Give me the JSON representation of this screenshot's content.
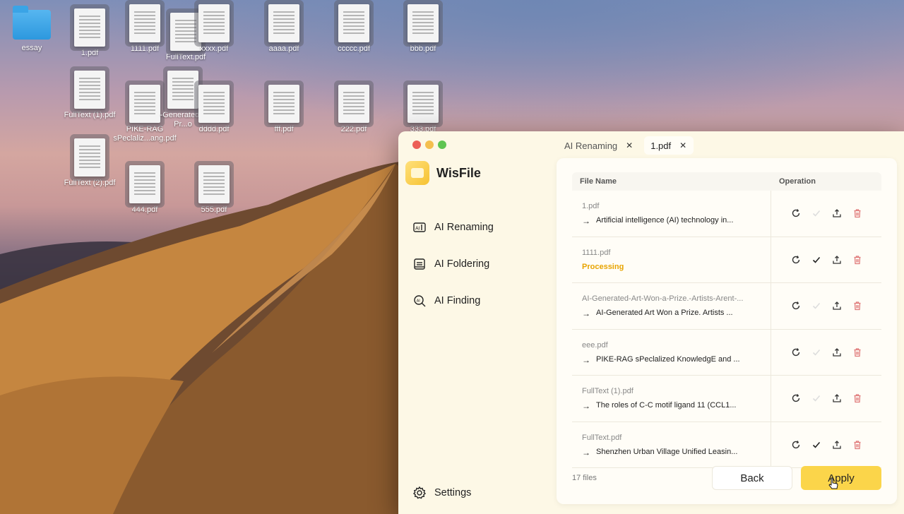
{
  "desktop": {
    "icons": [
      {
        "name": "essay",
        "type": "folder"
      },
      {
        "name": "1.pdf"
      },
      {
        "name": "1111.pdf"
      },
      {
        "name": "FullText.pdf"
      },
      {
        "name": "xxxx.pdf"
      },
      {
        "name": "aaaa.pdf"
      },
      {
        "name": "ccccc.pdf"
      },
      {
        "name": "bbb.pdf"
      },
      {
        "name": "FullText (1).pdf"
      },
      {
        "name": "PIKE-RAG sPeclaliz...ang.pdf"
      },
      {
        "name": "-Generated a Pr...o"
      },
      {
        "name": "dddd.pdf"
      },
      {
        "name": "fff.pdf"
      },
      {
        "name": "222.pdf"
      },
      {
        "name": "333.pdf"
      },
      {
        "name": "FullText (2).pdf"
      },
      {
        "name": "444.pdf"
      },
      {
        "name": "555.pdf"
      }
    ]
  },
  "app": {
    "name": "WisFile",
    "tabs": [
      {
        "label": "AI Renaming",
        "active": false
      },
      {
        "label": "1.pdf",
        "active": true
      }
    ],
    "nav": [
      {
        "label": "AI Renaming",
        "icon": "ai-rename-icon"
      },
      {
        "label": "AI Foldering",
        "icon": "ai-folder-icon"
      },
      {
        "label": "AI Finding",
        "icon": "ai-search-icon"
      }
    ],
    "settings_label": "Settings",
    "table": {
      "col_name": "File Name",
      "col_op": "Operation",
      "rows": [
        {
          "original": "1.pdf",
          "new": "Artificial intelligence (AI) technology in...",
          "status": "",
          "check_active": false
        },
        {
          "original": "1111.pdf",
          "new": "",
          "status": "Processing",
          "check_active": true
        },
        {
          "original": "AI-Generated-Art-Won-a-Prize.-Artists-Arent-...",
          "new": "AI-Generated Art Won a Prize. Artists ...",
          "status": "",
          "check_active": false
        },
        {
          "original": "eee.pdf",
          "new": "PIKE-RAG sPeclalized KnowledgE and ...",
          "status": "",
          "check_active": false
        },
        {
          "original": "FullText (1).pdf",
          "new": "The roles of C-C motif ligand 11 (CCL1...",
          "status": "",
          "check_active": false
        },
        {
          "original": "FullText.pdf",
          "new": "Shenzhen Urban Village Unified Leasin...",
          "status": "",
          "check_active": true
        }
      ]
    },
    "footer": {
      "count": "17 files",
      "back_label": "Back",
      "apply_label": "Apply"
    },
    "colors": {
      "accent": "#fbd54a",
      "processing": "#e8a400",
      "delete": "#e07a7a"
    }
  }
}
